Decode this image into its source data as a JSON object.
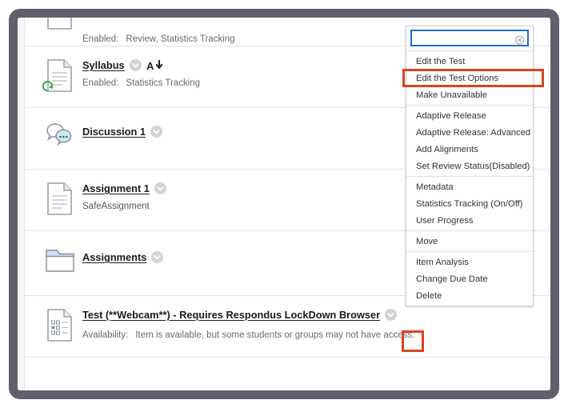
{
  "frame": {
    "border_color": "#5f5f6e",
    "highlight_color": "#d6461f",
    "focus_border_color": "#1c6fd0"
  },
  "content_rows": [
    {
      "title": null,
      "icon": "document-icon",
      "sub_label": "Enabled:",
      "sub_value": "Review, Statistics Tracking",
      "has_chevron": false,
      "has_adaptive_glyph": false
    },
    {
      "title": "Syllabus",
      "icon": "document-icon",
      "badge": "green-refresh-badge",
      "sub_label": "Enabled:",
      "sub_value": "Statistics Tracking",
      "has_chevron": true,
      "has_adaptive_glyph": true
    },
    {
      "title": "Discussion 1",
      "icon": "discussion-icon",
      "sub_label": "",
      "sub_value": "",
      "has_chevron": true,
      "has_adaptive_glyph": false
    },
    {
      "title": "Assignment 1",
      "icon": "document-icon",
      "sub_plain": "SafeAssignment",
      "has_chevron": true,
      "has_adaptive_glyph": false
    },
    {
      "title": "Assignments",
      "icon": "folder-icon",
      "has_chevron": true,
      "has_adaptive_glyph": false
    },
    {
      "title": "Test (**Webcam**) - Requires Respondus LockDown Browser",
      "icon": "test-document-icon",
      "sub_label": "Availability:",
      "sub_value": "Item is available, but some students or groups may not have access.",
      "has_chevron": true,
      "has_adaptive_glyph": false
    }
  ],
  "context_menu": {
    "search": {
      "value": "",
      "placeholder": "",
      "clear_icon": "clear-circle-icon"
    },
    "groups": [
      {
        "items": [
          {
            "label": "Edit the Test",
            "highlighted": false
          },
          {
            "label": "Edit the Test Options",
            "highlighted": true
          },
          {
            "label": "Make Unavailable",
            "highlighted": false
          }
        ]
      },
      {
        "items": [
          {
            "label": "Adaptive Release",
            "highlighted": false
          },
          {
            "label": "Adaptive Release: Advanced",
            "highlighted": false
          },
          {
            "label": "Add Alignments",
            "highlighted": false
          },
          {
            "label": "Set Review Status(Disabled)",
            "highlighted": false
          }
        ]
      },
      {
        "items": [
          {
            "label": "Metadata",
            "highlighted": false
          },
          {
            "label": "Statistics Tracking (On/Off)",
            "highlighted": false
          },
          {
            "label": "User Progress",
            "highlighted": false
          }
        ]
      },
      {
        "items": [
          {
            "label": "Move",
            "highlighted": false
          }
        ]
      },
      {
        "items": [
          {
            "label": "Item Analysis",
            "highlighted": false
          },
          {
            "label": "Change Due Date",
            "highlighted": false
          },
          {
            "label": "Delete",
            "highlighted": false
          }
        ]
      }
    ]
  }
}
